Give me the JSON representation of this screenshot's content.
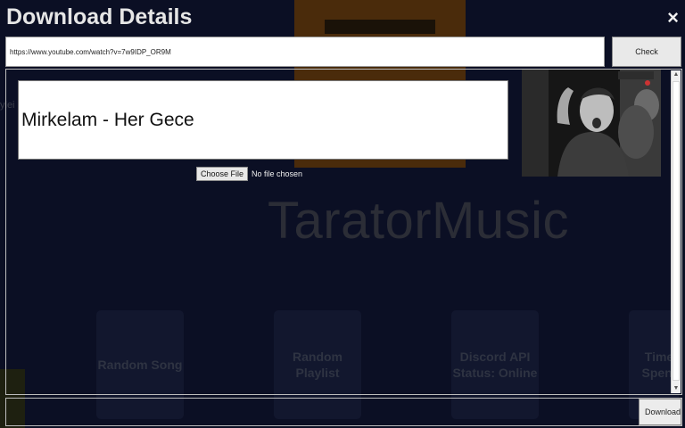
{
  "dialog": {
    "title": "Download Details",
    "close_icon": "×",
    "url_value": "https://www.youtube.com/watch?v=7w9IDP_OR9M",
    "check_label": "Check",
    "song_title_value": "Mirkelam - Her Gece",
    "choose_file_label": "Choose File",
    "file_status": "No file chosen",
    "download_label": "Download",
    "thumbnail_icon": "video-thumbnail-image"
  },
  "background": {
    "logo": "TaratorMusic",
    "cards": [
      {
        "label": "Random Song"
      },
      {
        "label": "Random Playlist"
      },
      {
        "label": "Discord API Status: Online"
      },
      {
        "label": "Time Spent"
      }
    ],
    "left_fragment": "ylei"
  },
  "colors": {
    "overlay_bg": "#0b0f24",
    "title_text": "#e6e6e6"
  }
}
